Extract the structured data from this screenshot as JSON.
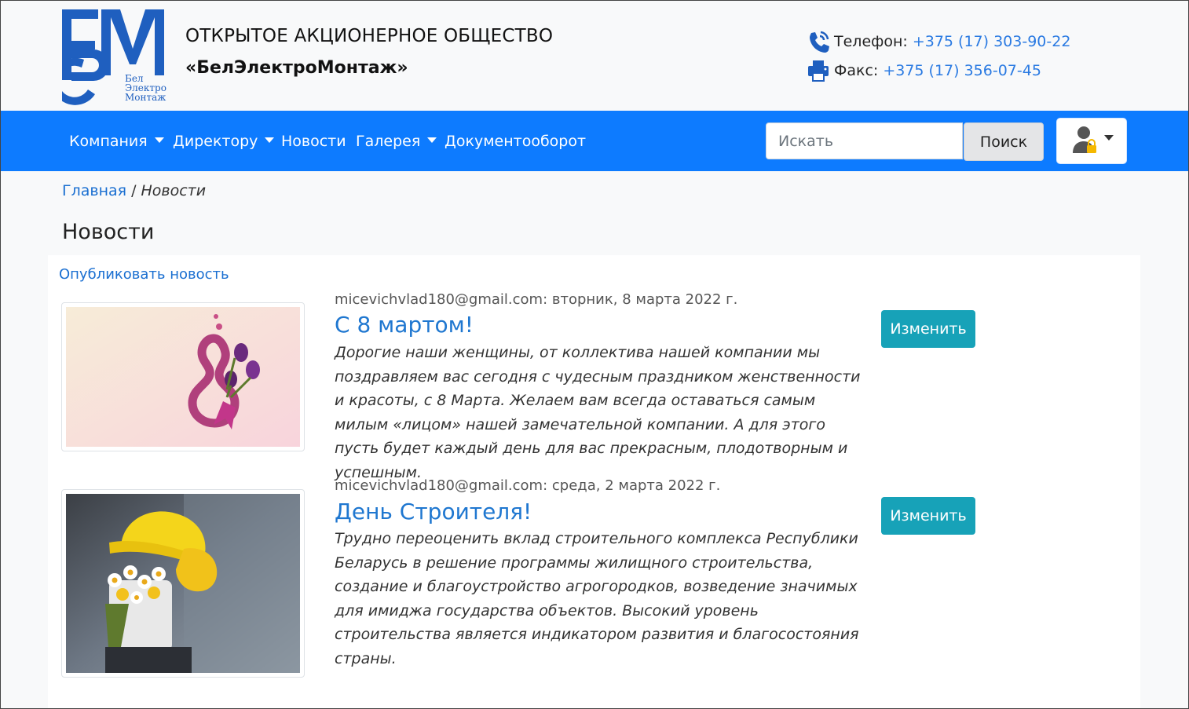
{
  "header": {
    "logo_letters": "БЭМ",
    "logo_caption": [
      "Бел",
      "Электро",
      "Монтаж"
    ],
    "company_line1": "ОТКРЫТОЕ АКЦИОНЕРНОЕ ОБЩЕСТВО",
    "company_line2": "«БелЭлектроМонтаж»",
    "phone": {
      "label": "Телефон:",
      "value": "+375 (17) 303-90-22",
      "icon": "phone-icon"
    },
    "fax": {
      "label": "Факс:",
      "value": "+375 (17) 356-07-45",
      "icon": "printer-icon"
    }
  },
  "navbar": {
    "items": [
      {
        "label": "Компания",
        "dropdown": true
      },
      {
        "label": "Директору",
        "dropdown": true
      },
      {
        "label": "Новости",
        "dropdown": false
      },
      {
        "label": "Галерея",
        "dropdown": true
      },
      {
        "label": "Документооборот",
        "dropdown": false
      }
    ],
    "search": {
      "placeholder": "Искать",
      "value": "",
      "button_label": "Поиск"
    },
    "user_menu": {
      "icon": "user-lock-icon"
    }
  },
  "breadcrumb": {
    "home": "Главная",
    "separator": "/",
    "current": "Новости"
  },
  "page_title": "Новости",
  "publish_link": "Опубликовать новость",
  "news": [
    {
      "meta": "micevichvlad180@gmail.com: вторник, 8 марта 2022 г.",
      "title": "С 8 мартом!",
      "text": "Дорогие наши женщины, от коллектива нашей компании мы поздравляем вас сегодня с чудесным праздником женственности и красоты, с 8 Марта. Желаем вам всегда оставаться самым милым «лицом» нашей замечательной компании. А для этого пусть будет каждый день для вас прекрасным, плодотворным и успешным.",
      "button": "Изменить"
    },
    {
      "meta": "micevichvlad180@gmail.com: среда, 2 марта 2022 г.",
      "title": "День Строителя!",
      "text": "Трудно переоценить вклад строительного комплекса Республики Беларусь в решение программы жилищного строительства, создание и благоустройство агрогородков, возведение значимых для имиджа государства объектов. Высокий уровень строительства является индикатором развития и благосостояния страны.",
      "button": "Изменить"
    }
  ],
  "colors": {
    "navbar": "#0d7bff",
    "link": "#1a6fd1",
    "edit_button": "#17a2b8",
    "logo": "#1f5fbf"
  }
}
